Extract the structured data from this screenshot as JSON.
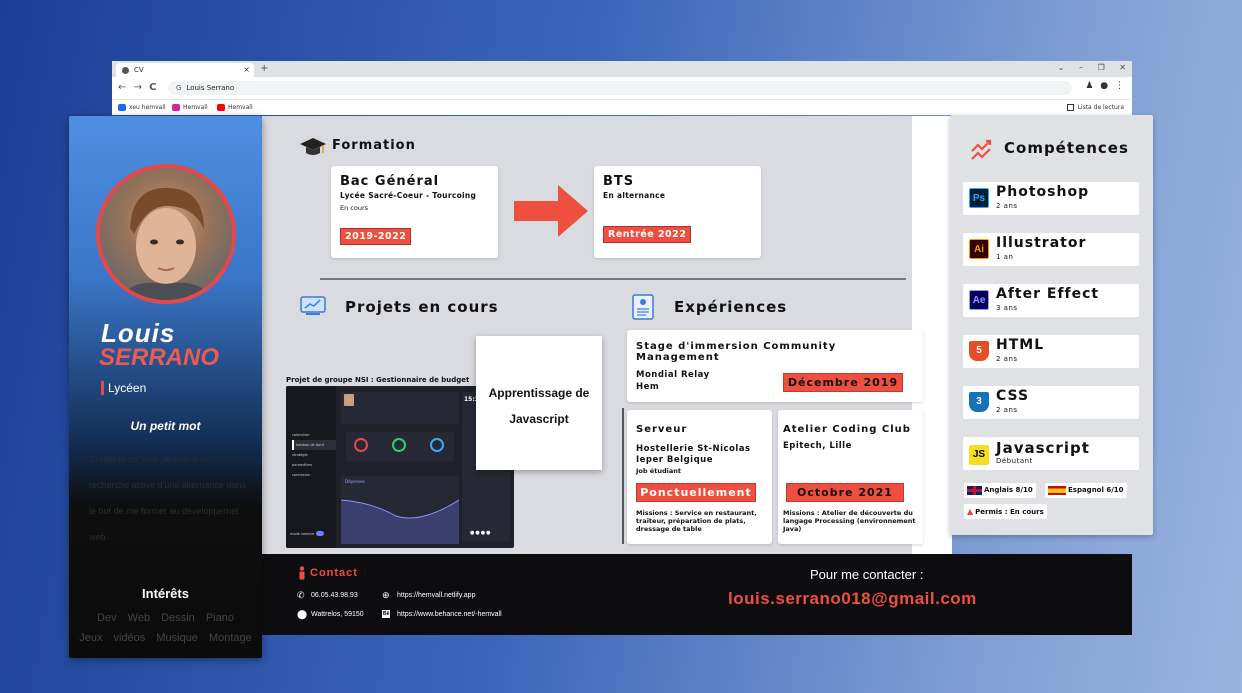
{
  "browser": {
    "tab_title": "CV",
    "tab_close": "×",
    "new_tab": "+",
    "window_controls": "⌄ – ❐ ✕",
    "address": "Louis Serrano",
    "bookmarks": [
      {
        "label": "xeu hemvall",
        "color": "#1769ff"
      },
      {
        "label": "Hemvall",
        "color": "#d6249f"
      },
      {
        "label": "Hemvall",
        "color": "#ff0000"
      }
    ],
    "reading_list": "Lista de lectura"
  },
  "sidebar": {
    "first_name": "Louis",
    "last_name": "SERRANO",
    "role": "Lycéen",
    "mot_title": "Un petit mot",
    "mot_text": "Créatif et curieux. Je suis à la recherche active d'une alternance dans le but de me former au développemet web.",
    "interests_title": "Intérêts",
    "interests_line1": "Dev Web   Dessin   Piano",
    "interests_line2": "Jeux vidéos  Musique  Montage"
  },
  "formation": {
    "title": "Formation",
    "cards": [
      {
        "title": "Bac Général",
        "school": "Lycée Sacré-Coeur - Tourcoing",
        "status": "En cours",
        "date": "2019-2022"
      },
      {
        "title": "BTS",
        "school": "En alternance",
        "status": "",
        "date": "Rentrée 2022"
      }
    ]
  },
  "projects": {
    "title": "Projets en cours",
    "caption": "Projet de groupe NSI : Gestionnaire de budget",
    "card_line1": "Apprentissage de",
    "card_line2": "Javascript"
  },
  "experiences": {
    "title": "Expériences",
    "items": [
      {
        "title": "Stage d'immersion Community Management",
        "place": "Mondial Relay",
        "place2": "Hem",
        "date": "Décembre 2019"
      },
      {
        "title": "Serveur",
        "place": "Hostellerie St-Nicolas",
        "place2": "Ieper Belgique",
        "note": "Job étudiant",
        "date": "Ponctuellement",
        "missions": "Missions : Service en restaurant, traiteur, préparation de plats, dressage de table"
      },
      {
        "title": "Atelier Coding Club",
        "place": "Epitech, Lille",
        "date": "Octobre 2021",
        "missions": "Missions : Atelier de découverte du langage Processing (environnement Java)"
      }
    ]
  },
  "skills": {
    "title": "Compétences",
    "items": [
      {
        "abbr": "Ps",
        "name": "Photoshop",
        "level": "2 ans",
        "bg": "#001e36",
        "fg": "#31a8ff"
      },
      {
        "abbr": "Ai",
        "name": "Illustrator",
        "level": "1 an",
        "bg": "#330000",
        "fg": "#ff9a00"
      },
      {
        "abbr": "Ae",
        "name": "After Effect",
        "level": "3 ans",
        "bg": "#00005b",
        "fg": "#9999ff"
      },
      {
        "abbr": "5",
        "name": "HTML",
        "level": "2 ans",
        "bg": "#e44d26",
        "fg": "#ffffff"
      },
      {
        "abbr": "3",
        "name": "CSS",
        "level": "2 ans",
        "bg": "#1572b6",
        "fg": "#ffffff"
      },
      {
        "abbr": "JS",
        "name": "Javascript",
        "level": "Débutant",
        "bg": "#f7df1e",
        "fg": "#000000"
      }
    ],
    "lang_en": "Anglais 8/10",
    "lang_es": "Espagnol 6/10",
    "permis": "Permis : En cours"
  },
  "contact": {
    "title": "Contact",
    "phone": "06.05.43.98.93",
    "address": "Wattrelos, 59150",
    "site": "https://hemvall.netlify.app",
    "behance": "https://www.behance.net/-hemvall",
    "cta": "Pour me contacter :",
    "email": "louis.serrano018@gmail.com"
  },
  "mockup": {
    "balance_label": "15:3",
    "menu": [
      "calendrier",
      "tableau de bord",
      "stratégie",
      "paramètres",
      "connexion"
    ],
    "chart_label": "Dépenses",
    "toggle_label": "mode sombre"
  }
}
